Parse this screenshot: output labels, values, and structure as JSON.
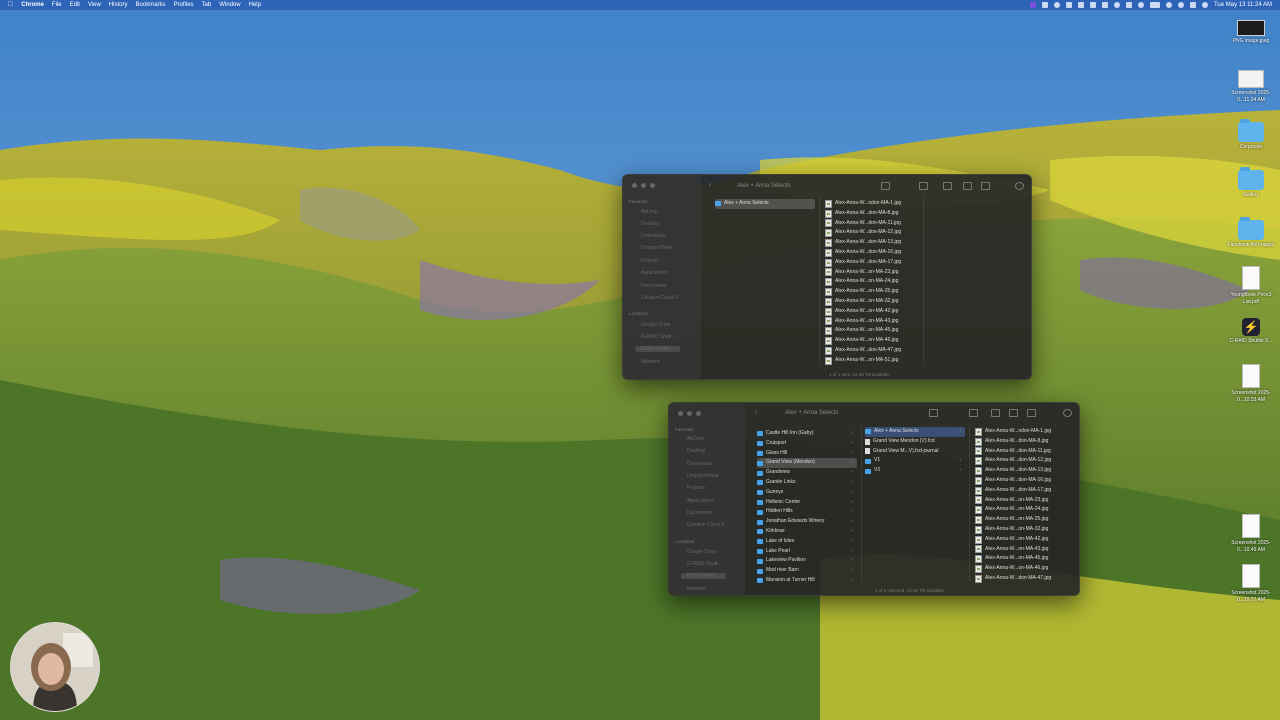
{
  "menubar": {
    "app": "Chrome",
    "items": [
      "File",
      "Edit",
      "View",
      "History",
      "Bookmarks",
      "Profiles",
      "Tab",
      "Window",
      "Help"
    ],
    "clock": "Tue May 13 11:24 AM"
  },
  "desktop": {
    "items": [
      {
        "label": "PNG image.jpeg",
        "icon": "dark-screenshot-icon"
      },
      {
        "label": "Screenshot 2025-0...11.24 AM",
        "icon": "screenshot-icon"
      },
      {
        "label": "Corporate",
        "icon": "folder-icon"
      },
      {
        "label": "Gallery",
        "icon": "folder-icon"
      },
      {
        "label": "Facebook Ad Images",
        "icon": "folder-icon"
      },
      {
        "label": "YoungBook Price3 List.pdf",
        "icon": "document-icon"
      },
      {
        "label": "C-RAID Shuttle S...",
        "icon": "app-icon"
      },
      {
        "label": "Screenshot 2025-0...10.53 AM",
        "icon": "document-icon"
      },
      {
        "label": "Screenshot 2025-0...10.49 AM",
        "icon": "document-icon"
      },
      {
        "label": "Screenshot 2025-0...10.27 AM",
        "icon": "document-icon"
      }
    ]
  },
  "finder1": {
    "title": "Alex + Anna Selects",
    "sidebar": {
      "favorites_head": "Favorites",
      "favorites": [
        "AirDrop",
        "Desktop",
        "Downloads",
        "Dropbox/Wine",
        "Projects",
        "Applications",
        "Documents",
        "Creative Cloud F..."
      ],
      "locations_head": "Locations",
      "locations": [
        "Google Drive",
        "G-RAID Shutt...",
        "PSSP-AMAC",
        "Network"
      ]
    },
    "col1": [
      "Alex + Anna Selects"
    ],
    "col2": [
      "Alex-Anna-W...ndon-MA-1.jpg",
      "Alex-Anna-W...don-MA-8.jpg",
      "Alex-Anna-W...don-MA-11.jpg",
      "Alex-Anna-W...don-MA-12.jpg",
      "Alex-Anna-W...don-MA-13.jpg",
      "Alex-Anna-W...don-MA-16.jpg",
      "Alex-Anna-W...don-MA-17.jpg",
      "Alex-Anna-W...on-MA-23.jpg",
      "Alex-Anna-W...on-MA-24.jpg",
      "Alex-Anna-W...on-MA-25.jpg",
      "Alex-Anna-W...on-MA-32.jpg",
      "Alex-Anna-W...on-MA-42.jpg",
      "Alex-Anna-W...on-MA-43.jpg",
      "Alex-Anna-W...on-MA-45.jpg",
      "Alex-Anna-W...on-MA-46.jpg",
      "Alex-Anna-W...don-MA-47.jpg",
      "Alex-Anna-W...on-MA-51.jpg"
    ],
    "status": "1 of 1 item, 22.58 TB available"
  },
  "finder2": {
    "title": "Alex + Anna Selects",
    "sidebar": {
      "favorites_head": "Favorites",
      "favorites": [
        "AirDrop",
        "Desktop",
        "Downloads",
        "Dropbox/Wine",
        "Projects",
        "Applications",
        "Documents",
        "Creative Cloud F..."
      ],
      "locations_head": "Locations",
      "locations": [
        "Google Drive",
        "G-RAID Shutt...",
        "PSSP-AMAC",
        "Network"
      ]
    },
    "col1": [
      "Castle Hill Inn (Gaby)",
      "Cruisport",
      "Glass Hill",
      "Grand View (Mendon)",
      "Grandview",
      "Granite Links",
      "Guneys",
      "Hellenic Center",
      "Hidden Hills",
      "Jonathan Edwards Winery",
      "Kirkbrae",
      "Lake of Isles",
      "Lake Pearl",
      "Lakeview Pavilion",
      "Mad river Barn",
      "Mansion at Turner Hill"
    ],
    "col2": [
      "Alex + Anna Selects",
      "Grand View Mendon (V).fcd",
      "Grand View M...V).fcd-journal",
      "V1",
      "V2"
    ],
    "col3": [
      "Alex-Anna-W...ndon-MA-1.jpg",
      "Alex-Anna-W...don-MA-8.jpg",
      "Alex-Anna-W...don-MA-11.jpg",
      "Alex-Anna-W...don-MA-12.jpg",
      "Alex-Anna-W...don-MA-13.jpg",
      "Alex-Anna-W...don-MA-16.jpg",
      "Alex-Anna-W...don-MA-17.jpg",
      "Alex-Anna-W...on-MA-23.jpg",
      "Alex-Anna-W...on-MA-24.jpg",
      "Alex-Anna-W...on-MA-25.jpg",
      "Alex-Anna-W...on-MA-32.jpg",
      "Alex-Anna-W...on-MA-42.jpg",
      "Alex-Anna-W...on-MA-43.jpg",
      "Alex-Anna-W...on-MA-45.jpg",
      "Alex-Anna-W...on-MA-46.jpg",
      "Alex-Anna-W...don-MA-47.jpg"
    ],
    "status": "1 of 5 selected, 22.58 TB available"
  }
}
